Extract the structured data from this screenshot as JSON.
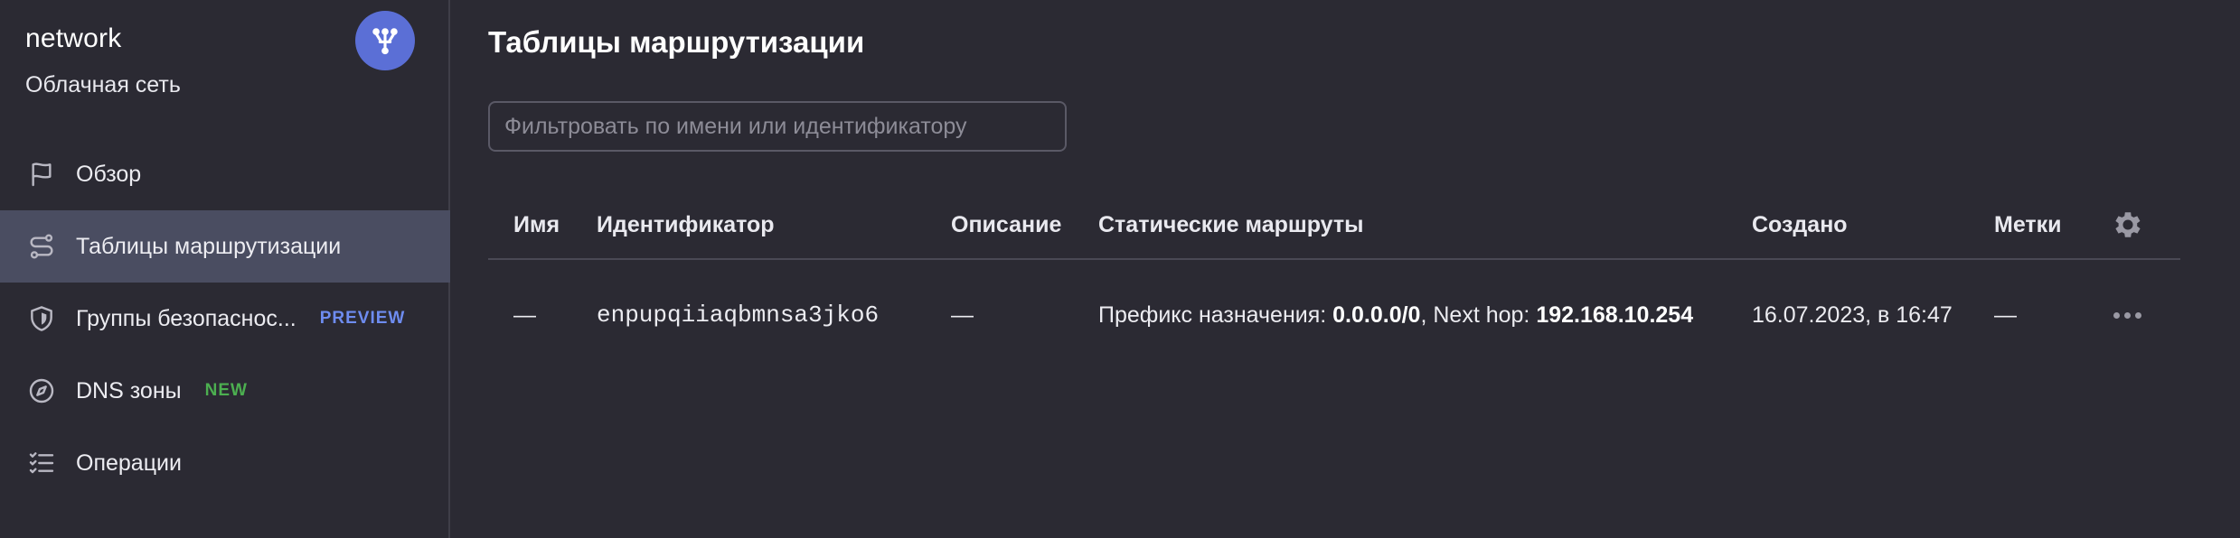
{
  "service": {
    "name": "network",
    "subtitle": "Облачная сеть",
    "avatar_icon": "network-icon",
    "avatar_color": "#5b6fd6"
  },
  "sidebar": {
    "items": [
      {
        "label": "Обзор",
        "icon": "flag-icon",
        "active": false,
        "badge": ""
      },
      {
        "label": "Таблицы маршрутизации",
        "icon": "route-icon",
        "active": true,
        "badge": ""
      },
      {
        "label": "Группы безопаснос...",
        "icon": "shield-icon",
        "active": false,
        "badge": "PREVIEW"
      },
      {
        "label": "DNS зоны",
        "icon": "compass-icon",
        "active": false,
        "badge": "NEW"
      },
      {
        "label": "Операции",
        "icon": "checklist-icon",
        "active": false,
        "badge": ""
      }
    ]
  },
  "main": {
    "title": "Таблицы маршрутизации",
    "filter_placeholder": "Фильтровать по имени или идентификатору",
    "filter_value": "",
    "table": {
      "columns": [
        "Имя",
        "Идентификатор",
        "Описание",
        "Статические маршруты",
        "Создано",
        "Метки"
      ],
      "rows": [
        {
          "name": "—",
          "id": "enpupqiiaqbmnsa3jko6",
          "description": "—",
          "routes": {
            "prefix_label": "Префикс назначения: ",
            "prefix_value": "0.0.0.0/0",
            "separator": ", Next hop: ",
            "next_hop": "192.168.10.254"
          },
          "created": "16.07.2023, в 16:47",
          "labels": "—"
        }
      ]
    }
  },
  "colors": {
    "background": "#2b2a33",
    "active_item": "#4a4d61",
    "preview_badge": "#6e8cf0",
    "new_badge": "#4caf50"
  }
}
